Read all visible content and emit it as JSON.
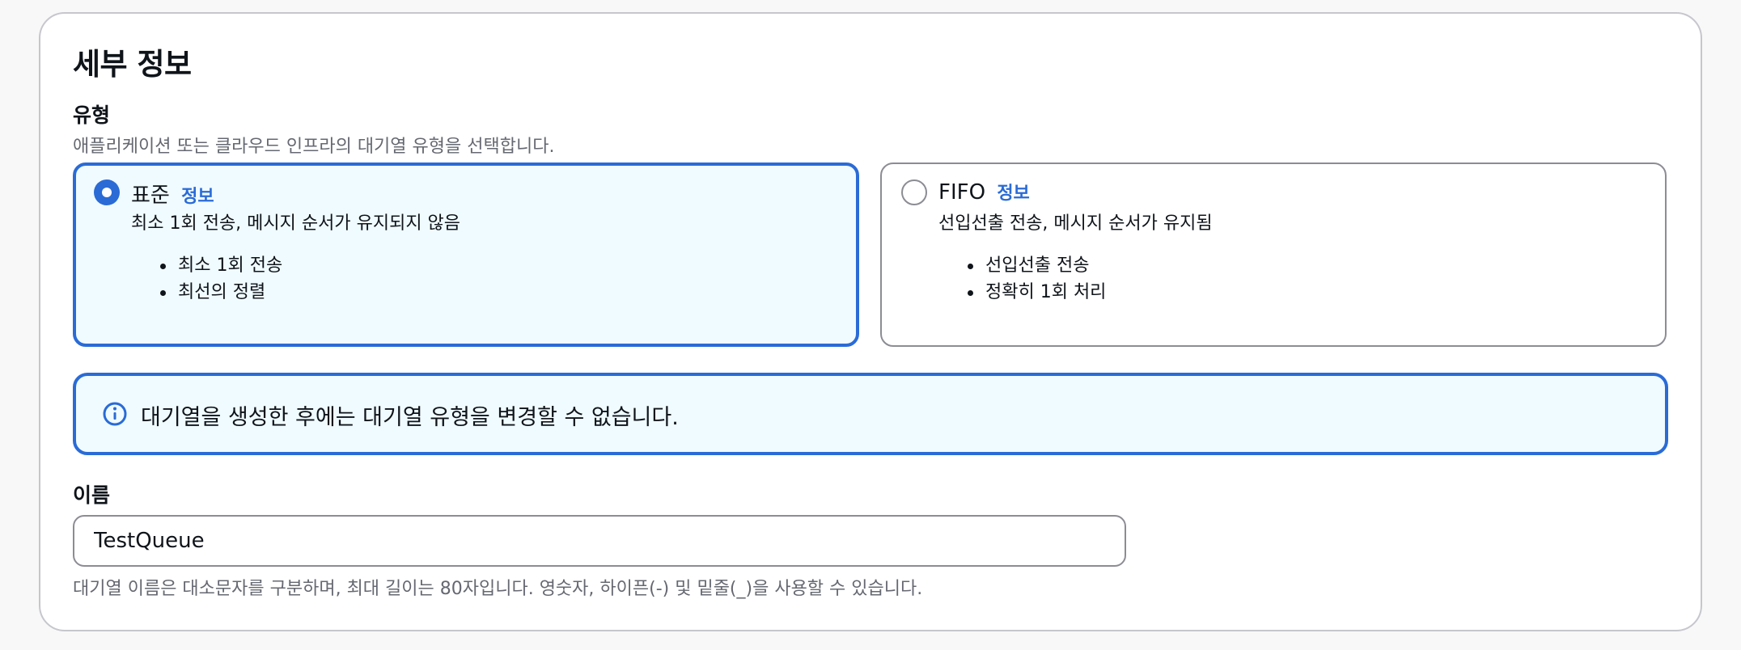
{
  "details": {
    "title": "세부 정보",
    "type": {
      "label": "유형",
      "description": "애플리케이션 또는 클라우드 인프라의 대기열 유형을 선택합니다.",
      "options": [
        {
          "title": "표준",
          "info": "정보",
          "subtitle": "최소 1회 전송, 메시지 순서가 유지되지 않음",
          "bullets": [
            "최소 1회 전송",
            "최선의 정렬"
          ],
          "selected": true
        },
        {
          "title": "FIFO",
          "info": "정보",
          "subtitle": "선입선출 전송, 메시지 순서가 유지됨",
          "bullets": [
            "선입선출 전송",
            "정확히 1회 처리"
          ],
          "selected": false
        }
      ]
    },
    "alert": {
      "icon": "info-icon",
      "text": "대기열을 생성한 후에는 대기열 유형을 변경할 수 없습니다."
    },
    "name": {
      "label": "이름",
      "value": "TestQueue",
      "hint": "대기열 이름은 대소문자를 구분하며, 최대 길이는 80자입니다. 영숫자, 하이픈(-) 및 밑줄(_)을 사용할 수 있습니다."
    }
  },
  "colors": {
    "accent": "#2a6bd6",
    "selected_background": "#f0fbff",
    "border": "#8c8c94"
  }
}
